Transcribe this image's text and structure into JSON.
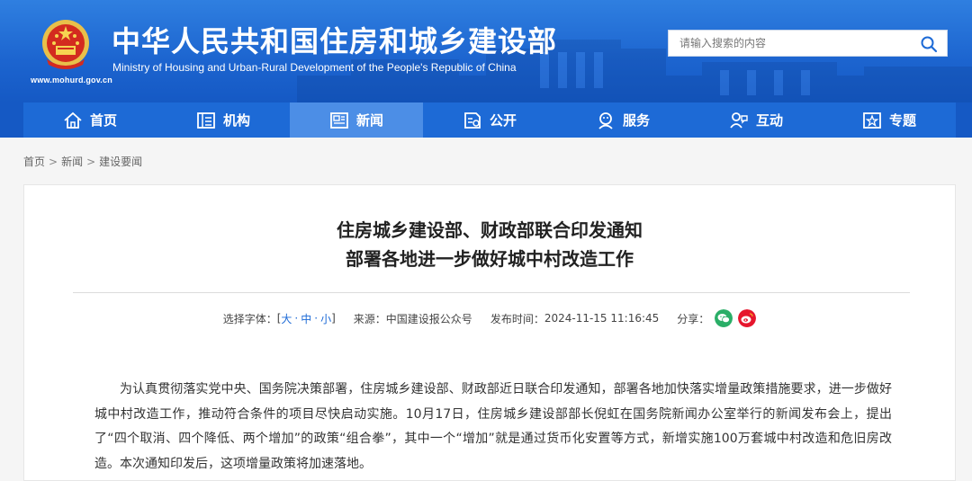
{
  "site": {
    "title_cn": "中华人民共和国住房和城乡建设部",
    "title_en": "Ministry of Housing and Urban-Rural Development of the People's Republic of China",
    "url": "www.mohurd.gov.cn"
  },
  "search": {
    "placeholder": "请输入搜索的内容"
  },
  "nav": [
    {
      "label": "首页",
      "icon": "home-icon"
    },
    {
      "label": "机构",
      "icon": "org-icon"
    },
    {
      "label": "新闻",
      "icon": "news-icon",
      "active": true
    },
    {
      "label": "公开",
      "icon": "open-icon"
    },
    {
      "label": "服务",
      "icon": "service-icon"
    },
    {
      "label": "互动",
      "icon": "interact-icon"
    },
    {
      "label": "专题",
      "icon": "topic-icon"
    }
  ],
  "breadcrumb": [
    "首页",
    "新闻",
    "建设要闻"
  ],
  "article": {
    "title_line1": "住房城乡建设部、财政部联合印发通知",
    "title_line2": "部署各地进一步做好城中村改造工作",
    "font_label": "选择字体：",
    "font_large": "大",
    "font_medium": "中",
    "font_small": "小",
    "source_label": "来源：",
    "source": "中国建设报公众号",
    "date_label": "发布时间：",
    "date": "2024-11-15 11:16:45",
    "share_label": "分享：",
    "share_icons": [
      "wechat-icon",
      "weibo-icon"
    ],
    "body": "为认真贯彻落实党中央、国务院决策部署，住房城乡建设部、财政部近日联合印发通知，部署各地加快落实增量政策措施要求，进一步做好城中村改造工作，推动符合条件的项目尽快启动实施。10月17日，住房城乡建设部部长倪虹在国务院新闻办公室举行的新闻发布会上，提出了“四个取消、四个降低、两个增加”的政策“组合拳”，其中一个“增加”就是通过货币化安置等方式，新增实施100万套城中村改造和危旧房改造。本次通知印发后，这项增量政策将加速落地。"
  },
  "colors": {
    "header": "#1d6ad6",
    "nav_active": "#4c8ee6",
    "link": "#1d6ad6"
  }
}
